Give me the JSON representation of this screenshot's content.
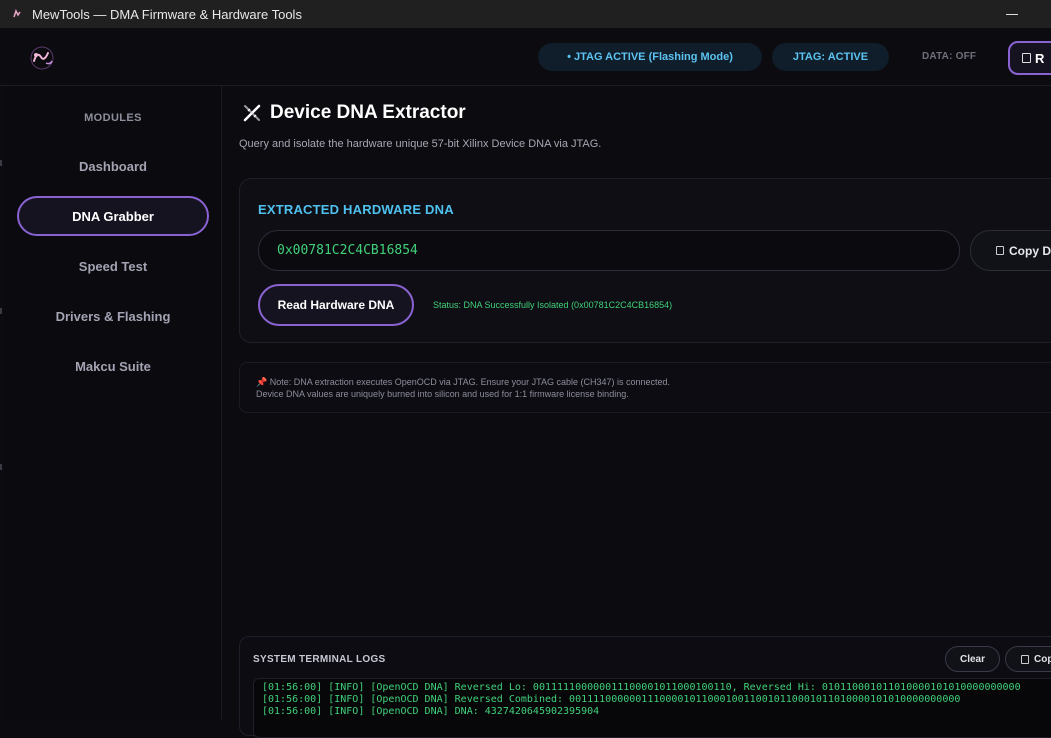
{
  "window": {
    "title": "MewTools — DMA Firmware & Hardware Tools"
  },
  "header": {
    "jtag_mode_pill": "• JTAG ACTIVE (Flashing Mode)",
    "jtag_status_pill": "JTAG: ACTIVE",
    "data_status": "DATA: OFF",
    "action_button_label": "R",
    "colors": {
      "accent": "#8a63d2",
      "info": "#5cc3f2",
      "success": "#41d17a"
    }
  },
  "sidebar": {
    "heading": "MODULES",
    "items": [
      {
        "label": "Dashboard",
        "active": false
      },
      {
        "label": "DNA Grabber",
        "active": true
      },
      {
        "label": "Speed Test",
        "active": false
      },
      {
        "label": "Drivers & Flashing",
        "active": false
      },
      {
        "label": "Makcu Suite",
        "active": false
      }
    ]
  },
  "main": {
    "title": "Device DNA Extractor",
    "subtitle": "Query and isolate the hardware unique 57-bit Xilinx Device DNA via JTAG.",
    "card": {
      "label": "EXTRACTED HARDWARE DNA",
      "dna_value": "0x00781C2C4CB16854",
      "copy_label": "Copy DN",
      "read_button": "Read Hardware DNA",
      "status": "Status: DNA Successfully Isolated (0x00781C2C4CB16854)"
    },
    "note": {
      "line1": "📌 Note: DNA extraction executes OpenOCD via JTAG. Ensure your JTAG cable (CH347) is connected.",
      "line2": "Device DNA values are uniquely burned into silicon and used for 1:1 firmware license binding."
    },
    "terminal": {
      "title": "SYSTEM TERMINAL LOGS",
      "clear_label": "Clear",
      "copy_label": "Cop",
      "lines": [
        "[01:56:00] [INFO] [OpenOCD DNA] Reversed Lo: 0011111000000111000010110001001​10, Reversed Hi: 010110001011010000101010000000000",
        "[01:56:00] [INFO] [OpenOCD DNA] Reversed Combined: 00111100000011100001011000100110010110001011010000101010000000000",
        "[01:56:00] [INFO] [OpenOCD DNA] DNA: 4327420645902395904"
      ]
    }
  }
}
